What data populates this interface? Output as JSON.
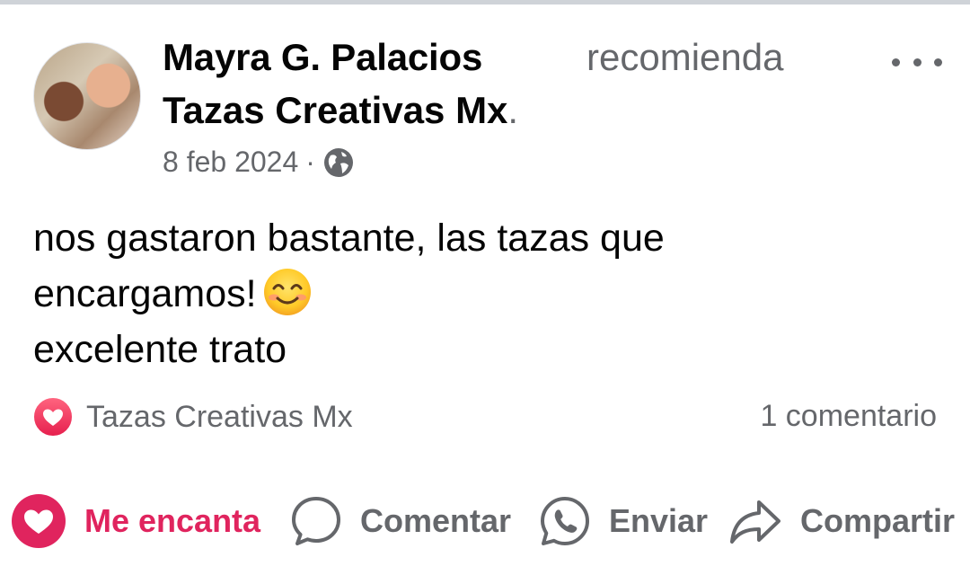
{
  "post": {
    "author": "Mayra G. Palacios",
    "action_text": "recomienda",
    "page_name": "Tazas Creativas Mx",
    "page_suffix": ".",
    "date": "8 feb 2024",
    "separator": "·",
    "audience_icon": "globe-icon",
    "more_icon": "more-options-icon",
    "text_lines": [
      "nos gastaron bastante, las tazas que",
      "encargamos!",
      "excelente trato"
    ],
    "emoji_icon": "smiling-face-icon"
  },
  "engagement": {
    "reaction_icon": "love-reaction-icon",
    "reactor_name": "Tazas Creativas Mx",
    "comments_label": "1 comentario"
  },
  "actions": {
    "love": {
      "label": "Me encanta",
      "icon": "heart-icon",
      "active": true,
      "color": "#e0245e"
    },
    "comment": {
      "label": "Comentar",
      "icon": "comment-bubble-icon"
    },
    "send": {
      "label": "Enviar",
      "icon": "whatsapp-icon"
    },
    "share": {
      "label": "Compartir",
      "icon": "share-arrow-icon"
    }
  },
  "colors": {
    "text_primary": "#050505",
    "text_secondary": "#65676b",
    "love_red": "#e0245e"
  }
}
